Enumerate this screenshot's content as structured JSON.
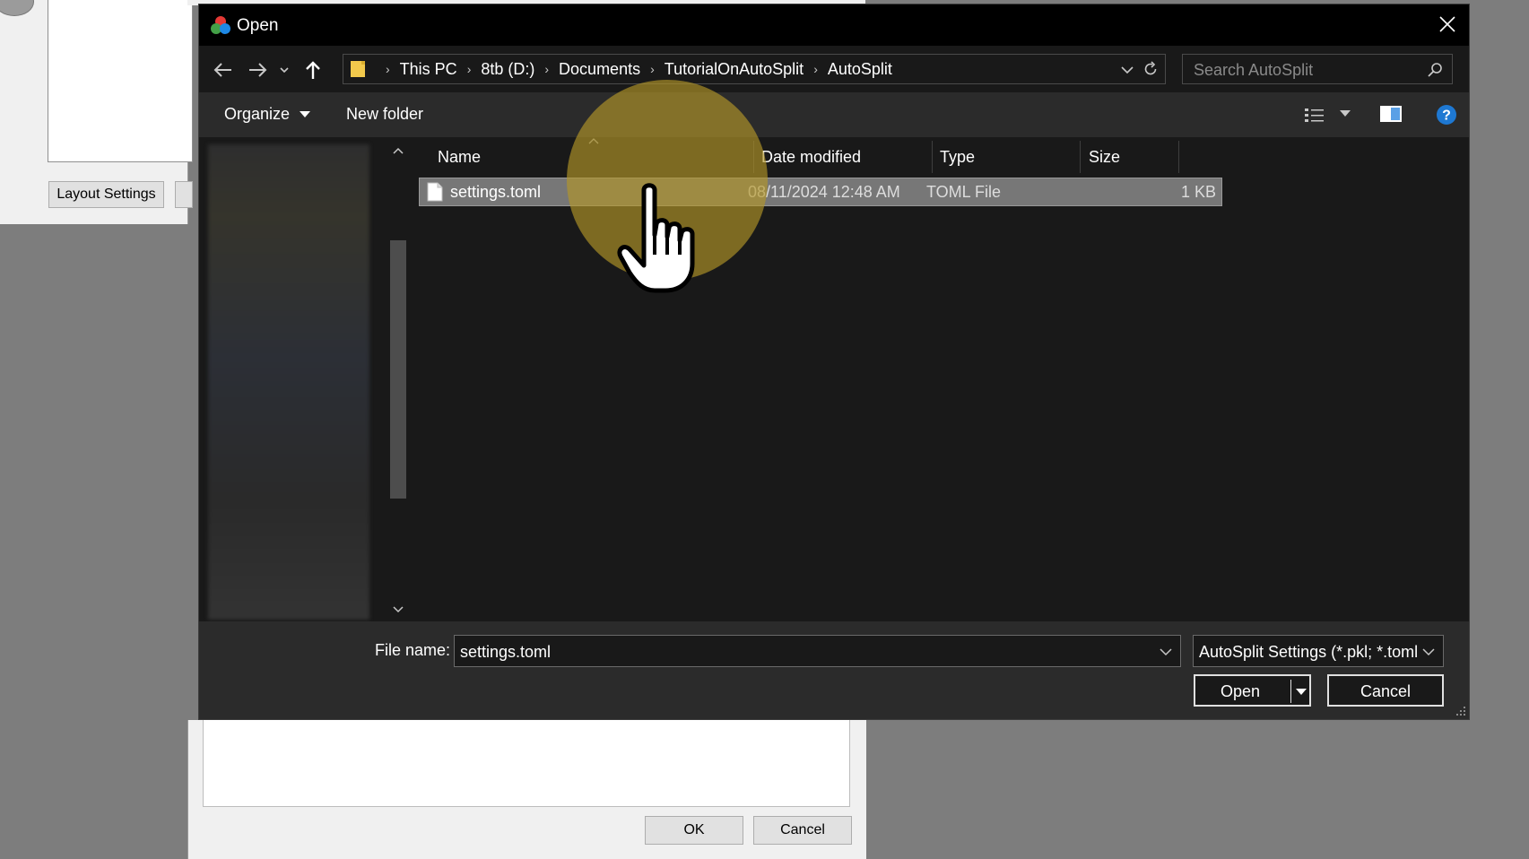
{
  "background_app": {
    "layout_settings_label": "Layout Settings",
    "ok_label": "OK",
    "cancel_label": "Cancel"
  },
  "dialog": {
    "title": "Open",
    "breadcrumbs": [
      "This PC",
      "8tb (D:)",
      "Documents",
      "TutorialOnAutoSplit",
      "AutoSplit"
    ],
    "search_placeholder": "Search AutoSplit",
    "toolbar": {
      "organize_label": "Organize",
      "new_folder_label": "New folder"
    },
    "columns": {
      "name": "Name",
      "date_modified": "Date modified",
      "type": "Type",
      "size": "Size"
    },
    "files": [
      {
        "name": "settings.toml",
        "date_modified": "08/11/2024 12:48 AM",
        "type": "TOML File",
        "size": "1 KB",
        "selected": true
      }
    ],
    "file_name_label": "File name:",
    "file_name_value": "settings.toml",
    "file_type_filter": "AutoSplit Settings (*.pkl; *.toml",
    "open_label": "Open",
    "cancel_label": "Cancel"
  },
  "colors": {
    "titlebar": "#000000",
    "toolbar": "#2b2b2b",
    "selection": "#777777",
    "highlight": "#b49628",
    "help_icon": "#1e78d2",
    "folder_icon": "#f2c94c"
  },
  "icons": {
    "app": "app-logo-icon",
    "close": "close-icon",
    "back": "back-arrow-icon",
    "forward": "forward-arrow-icon",
    "recent": "recent-locations-chevron-icon",
    "up": "up-arrow-icon",
    "folder": "folder-icon",
    "refresh": "refresh-icon",
    "search": "search-icon",
    "view": "view-details-icon",
    "preview": "preview-pane-icon",
    "help": "help-icon",
    "file": "file-icon",
    "cursor": "hand-pointer-icon"
  }
}
